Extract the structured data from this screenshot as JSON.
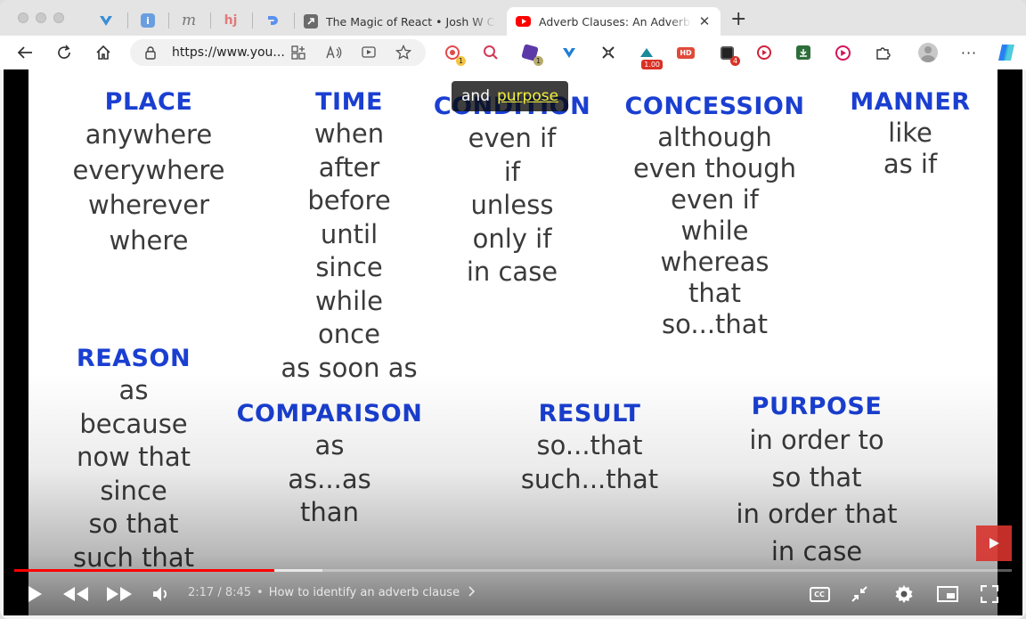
{
  "tabs": {
    "pinned": [
      "vivaldi-icon",
      "info-icon",
      "m-icon",
      "hj-icon",
      "d-icon"
    ],
    "items": [
      {
        "title": "The Magic of React • Josh W Comeau",
        "favicon": "arrow-icon"
      },
      {
        "title": "Adverb Clauses: An Adverb Clause",
        "favicon": "youtube-icon"
      }
    ],
    "new_tab": "+"
  },
  "toolbar": {
    "url": "https://www.you..."
  },
  "extensions": {
    "badge_1": "1",
    "badge_2": "1",
    "badge_speed": "1.00",
    "badge_hd": "HD",
    "badge_4": "4"
  },
  "caption": {
    "word1": "and",
    "word2": "purpose"
  },
  "slide": {
    "place": {
      "heading": "PLACE",
      "items": [
        "anywhere",
        "everywhere",
        "wherever",
        "where"
      ]
    },
    "time": {
      "heading": "TIME",
      "items": [
        "when",
        "after",
        "before",
        "until",
        "since",
        "while",
        "once",
        "as soon as"
      ]
    },
    "condition": {
      "heading": "CONDITION",
      "items": [
        "even if",
        "if",
        "unless",
        "only if",
        "in case"
      ]
    },
    "concession": {
      "heading": "CONCESSION",
      "items": [
        "although",
        "even though",
        "even if",
        "while",
        "whereas",
        "that",
        "so...that"
      ]
    },
    "manner": {
      "heading": "MANNER",
      "items": [
        "like",
        "as if"
      ]
    },
    "reason": {
      "heading": "REASON",
      "items": [
        "as",
        "because",
        "now that",
        "since",
        "so that",
        "such that"
      ]
    },
    "comparison": {
      "heading": "COMPARISON",
      "items": [
        "as",
        "as...as",
        "than"
      ]
    },
    "result": {
      "heading": "RESULT",
      "items": [
        "so...that",
        "such...that"
      ]
    },
    "purpose": {
      "heading": "PURPOSE",
      "items": [
        "in order to",
        "so that",
        "in order that",
        "in case"
      ]
    }
  },
  "player": {
    "current_time": "2:17",
    "duration": "8:45",
    "time_display": "2:17 / 8:45",
    "separator": "•",
    "chapter": "How to identify an adverb clause",
    "played_fraction": 0.261,
    "buffered_fraction": 0.309,
    "cc_label": "CC",
    "accent_color": "#ff0000"
  },
  "colors": {
    "heading": "#1a3fd1",
    "body_text": "#3b3b3b",
    "caption_highlight": "#f3ef3a"
  }
}
